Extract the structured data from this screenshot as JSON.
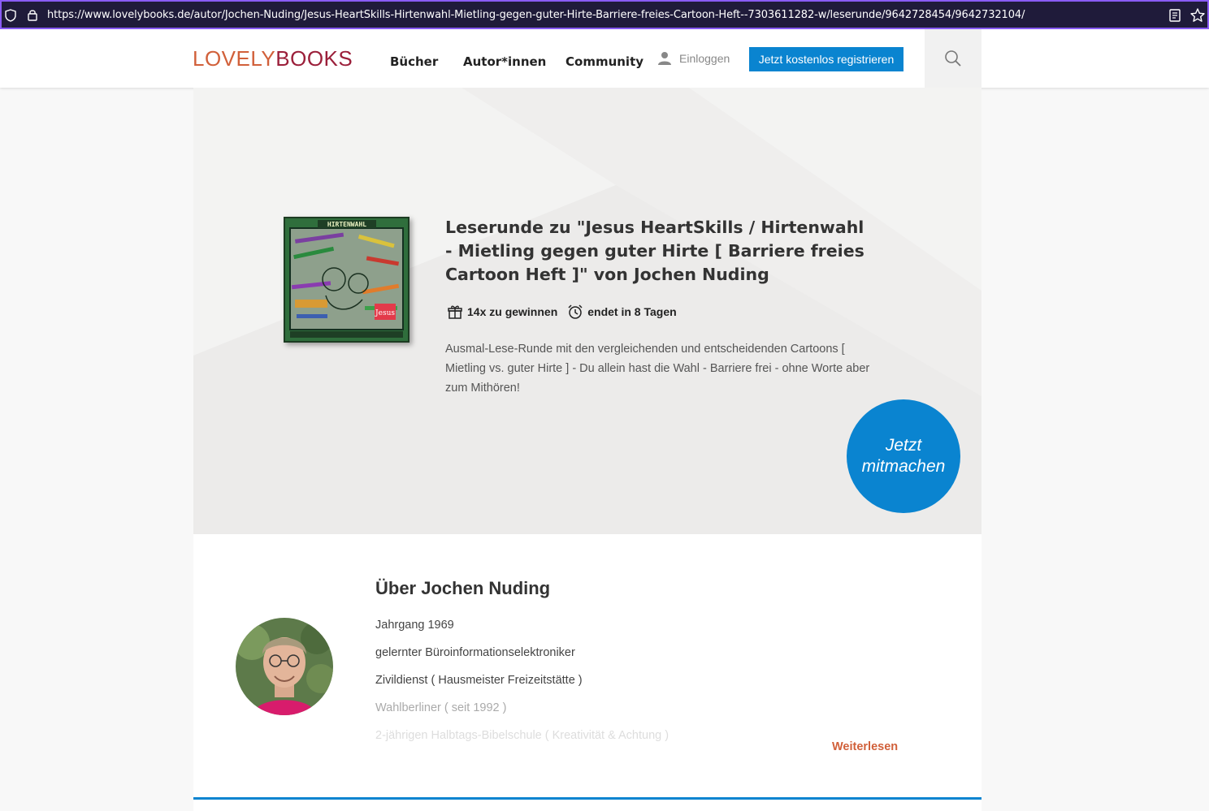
{
  "browser": {
    "url": "https://www.lovelybooks.de/autor/Jochen-Nuding/Jesus-HeartSkills-Hirtenwahl-Mietling-gegen-guter-Hirte-Barriere-freies-Cartoon-Heft--7303611282-w/leserunde/9642728454/9642732104/"
  },
  "header": {
    "logo_part1": "LOVELY",
    "logo_part2": "BOOKS",
    "nav": [
      "Bücher",
      "Autor*innen",
      "Community"
    ],
    "login_label": "Einloggen",
    "register_label": "Jetzt kostenlos registrieren"
  },
  "hero": {
    "title": "Leserunde zu \"Jesus HeartSkills / Hirtenwahl - Mietling gegen guter Hirte [ Barriere freies Cartoon Heft ]\" von Jochen Nuding",
    "prizes": "14x zu gewinnen",
    "ends": "endet in 8 Tagen",
    "description": "Ausmal-Lese-Runde mit den vergleichenden und entscheidenden Cartoons [ Mietling vs. guter Hirte ]  - Du allein hast die Wahl - Barriere frei - ohne Worte aber zum Mithören!",
    "join_line1": "Jetzt",
    "join_line2": "mitmachen",
    "cover_title": "HIRTENWAHL",
    "cover_tag": "Jesus"
  },
  "about": {
    "title": "Über Jochen Nuding",
    "lines": [
      "Jahrgang 1969",
      "gelernter Büroinformationselektroniker",
      "Zivildienst ( Hausmeister Freizeitstätte )",
      "Wahlberliner ( seit 1992 )",
      "2-jährigen Halbtags-Bibelschule ( Kreativität & Achtung )"
    ],
    "read_more": "Weiterlesen"
  },
  "colors": {
    "accent_blue": "#0a84d0",
    "logo_orange": "#d1603a",
    "logo_red": "#9b1f3a",
    "urlbar_bg": "#1f1b3a",
    "urlbar_border": "#8a5cf5"
  }
}
